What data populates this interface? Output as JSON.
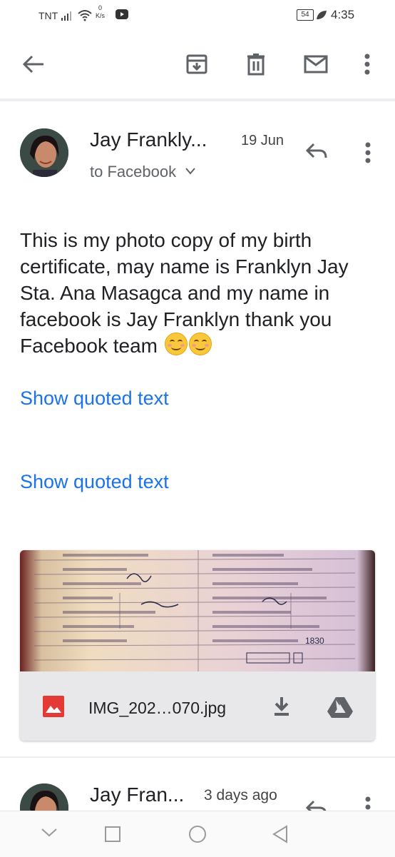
{
  "status_bar": {
    "carrier": "TNT",
    "speed_value": "0",
    "speed_unit": "K/s",
    "battery": "54",
    "time": "4:35"
  },
  "toolbar": {
    "icons": [
      "back-arrow-icon",
      "archive-icon",
      "delete-icon",
      "mark-unread-icon",
      "more-vert-icon"
    ]
  },
  "message": {
    "sender": "Jay Frankly...",
    "date": "19 Jun",
    "recipient": "to Facebook",
    "body": "This is my photo copy of my birth certificate, may name is Franklyn Jay Sta. Ana Masagca and my name in facebook is Jay Franklyn thank you Facebook team",
    "quoted_1": "Show quoted text",
    "quoted_2": "Show quoted text",
    "attachment": {
      "filename": "IMG_202…070.jpg",
      "badge": "1830"
    }
  },
  "next_message": {
    "sender": "Jay Fran...",
    "date": "3 days ago"
  },
  "colors": {
    "link": "#1a73e8",
    "image_icon": "#e53935",
    "icon_gray": "#5f6368"
  }
}
